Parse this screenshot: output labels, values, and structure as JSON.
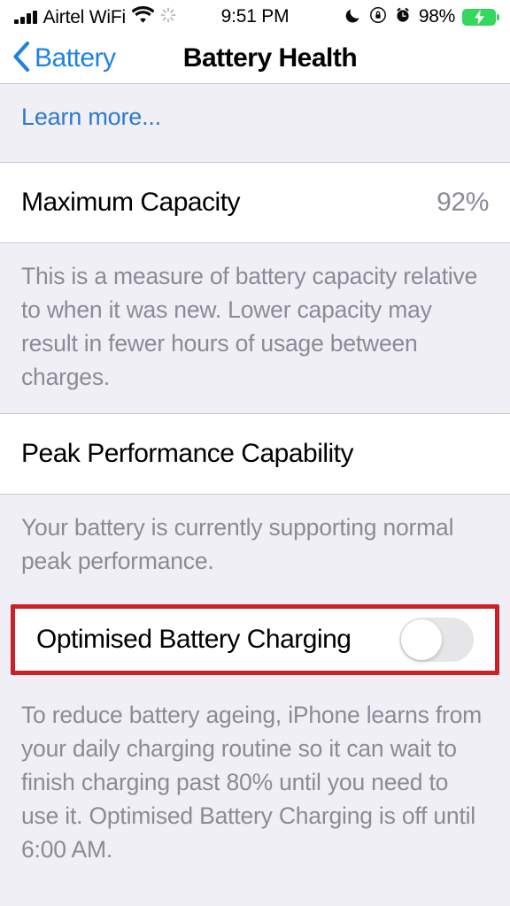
{
  "status_bar": {
    "carrier": "Airtel WiFi",
    "time": "9:51 PM",
    "battery_percent": "98%",
    "icons": {
      "signal": "signal-bars-icon",
      "wifi": "wifi-icon",
      "activity": "activity-spinner-icon",
      "dnd": "moon-icon",
      "rotation_lock": "rotation-lock-icon",
      "alarm": "alarm-clock-icon",
      "battery": "battery-charging-icon"
    }
  },
  "nav": {
    "back_label": "Battery",
    "title": "Battery Health"
  },
  "sections": {
    "learn_more": {
      "link_label": "Learn more..."
    },
    "maximum_capacity": {
      "title": "Maximum Capacity",
      "value": "92%",
      "footer": "This is a measure of battery capacity relative to when it was new. Lower capacity may result in fewer hours of usage between charges."
    },
    "peak_performance": {
      "title": "Peak Performance Capability",
      "footer": "Your battery is currently supporting normal peak performance."
    },
    "optimised_charging": {
      "title": "Optimised Battery Charging",
      "toggle_state": "off",
      "footer": "To reduce battery ageing, iPhone learns from your daily charging routine so it can wait to finish charging past 80% until you need to use it. Optimised Battery Charging is off until 6:00 AM."
    }
  },
  "colors": {
    "accent_blue": "#1e82e2",
    "link_blue": "#2a7ad2",
    "group_background": "#f0eff6",
    "cell_background": "#ffffff",
    "secondary_text": "#8b8b96",
    "highlight_red": "#cc2029",
    "battery_green": "#33d95c"
  }
}
